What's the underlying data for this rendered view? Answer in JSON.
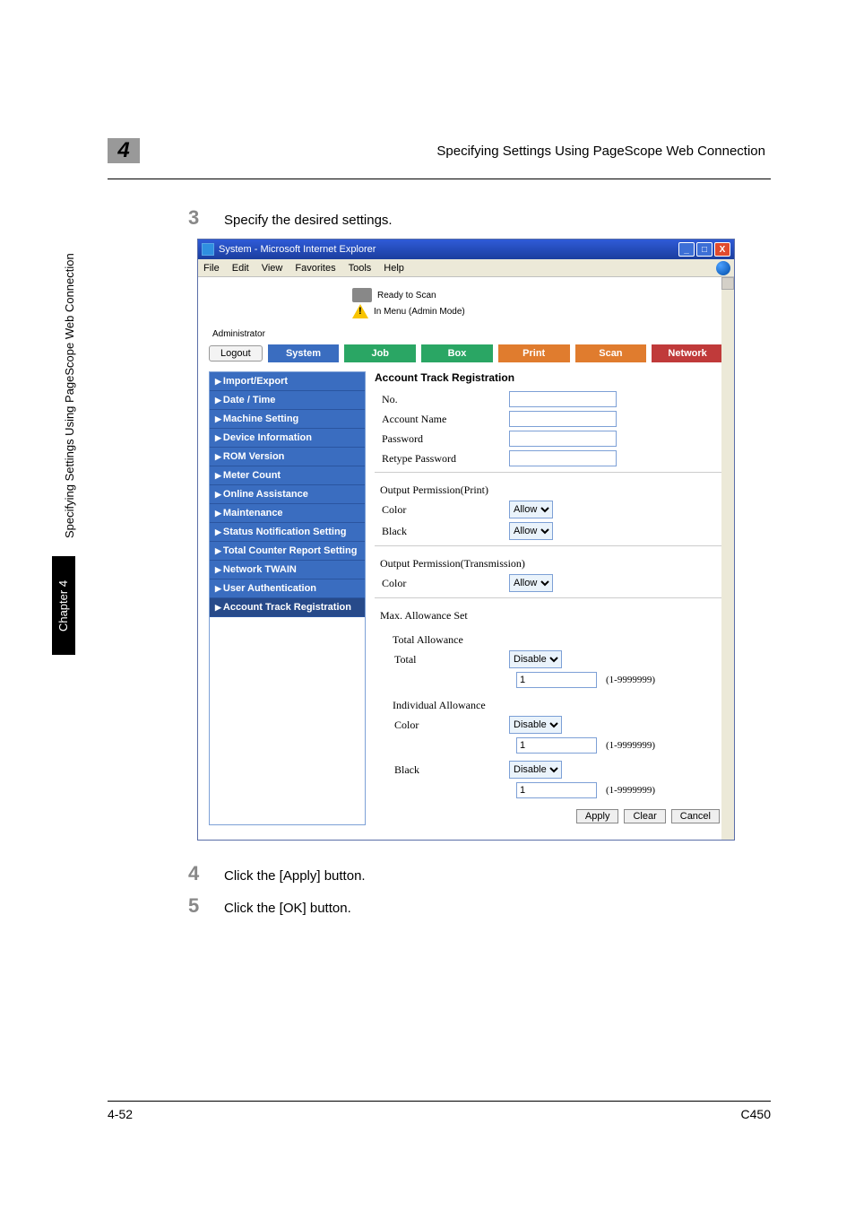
{
  "page_header": {
    "chapter_number": "4",
    "running_title": "Specifying Settings Using PageScope Web Connection"
  },
  "steps": {
    "s3": {
      "num": "3",
      "text": "Specify the desired settings."
    },
    "s4": {
      "num": "4",
      "text": "Click the [Apply] button."
    },
    "s5": {
      "num": "5",
      "text": "Click the [OK] button."
    }
  },
  "side_label": "Specifying Settings Using PageScope Web Connection",
  "chapter_tab": "Chapter 4",
  "footer": {
    "left": "4-52",
    "right": "C450"
  },
  "browser": {
    "title": "System - Microsoft Internet Explorer",
    "menu": {
      "file": "File",
      "edit": "Edit",
      "view": "View",
      "favorites": "Favorites",
      "tools": "Tools",
      "help": "Help"
    },
    "status": {
      "line1": "Ready to Scan",
      "line2": "In Menu (Admin Mode)"
    },
    "admin_label": "Administrator",
    "logout": "Logout",
    "tabs": {
      "system": "System",
      "job": "Job",
      "box": "Box",
      "print": "Print",
      "scan": "Scan",
      "network": "Network"
    },
    "sidebar": [
      "Import/Export",
      "Date / Time",
      "Machine Setting",
      "Device Information",
      "ROM Version",
      "Meter Count",
      "Online Assistance",
      "Maintenance",
      "Status Notification Setting",
      "Total Counter Report Setting",
      "Network TWAIN",
      "User Authentication",
      "Account Track Registration"
    ],
    "form": {
      "heading": "Account Track Registration",
      "no": "No.",
      "account_name": "Account Name",
      "password": "Password",
      "retype_password": "Retype Password",
      "output_print": "Output Permission(Print)",
      "color": "Color",
      "black": "Black",
      "output_trans": "Output Permission(Transmission)",
      "max_allowance": "Max. Allowance Set",
      "total_allowance": "Total Allowance",
      "total": "Total",
      "individual_allowance": "Individual Allowance",
      "allow_options": [
        "Allow"
      ],
      "disable_options": [
        "Disable"
      ],
      "num_value": "1",
      "range_hint": "(1-9999999)",
      "apply": "Apply",
      "clear": "Clear",
      "cancel": "Cancel"
    }
  }
}
